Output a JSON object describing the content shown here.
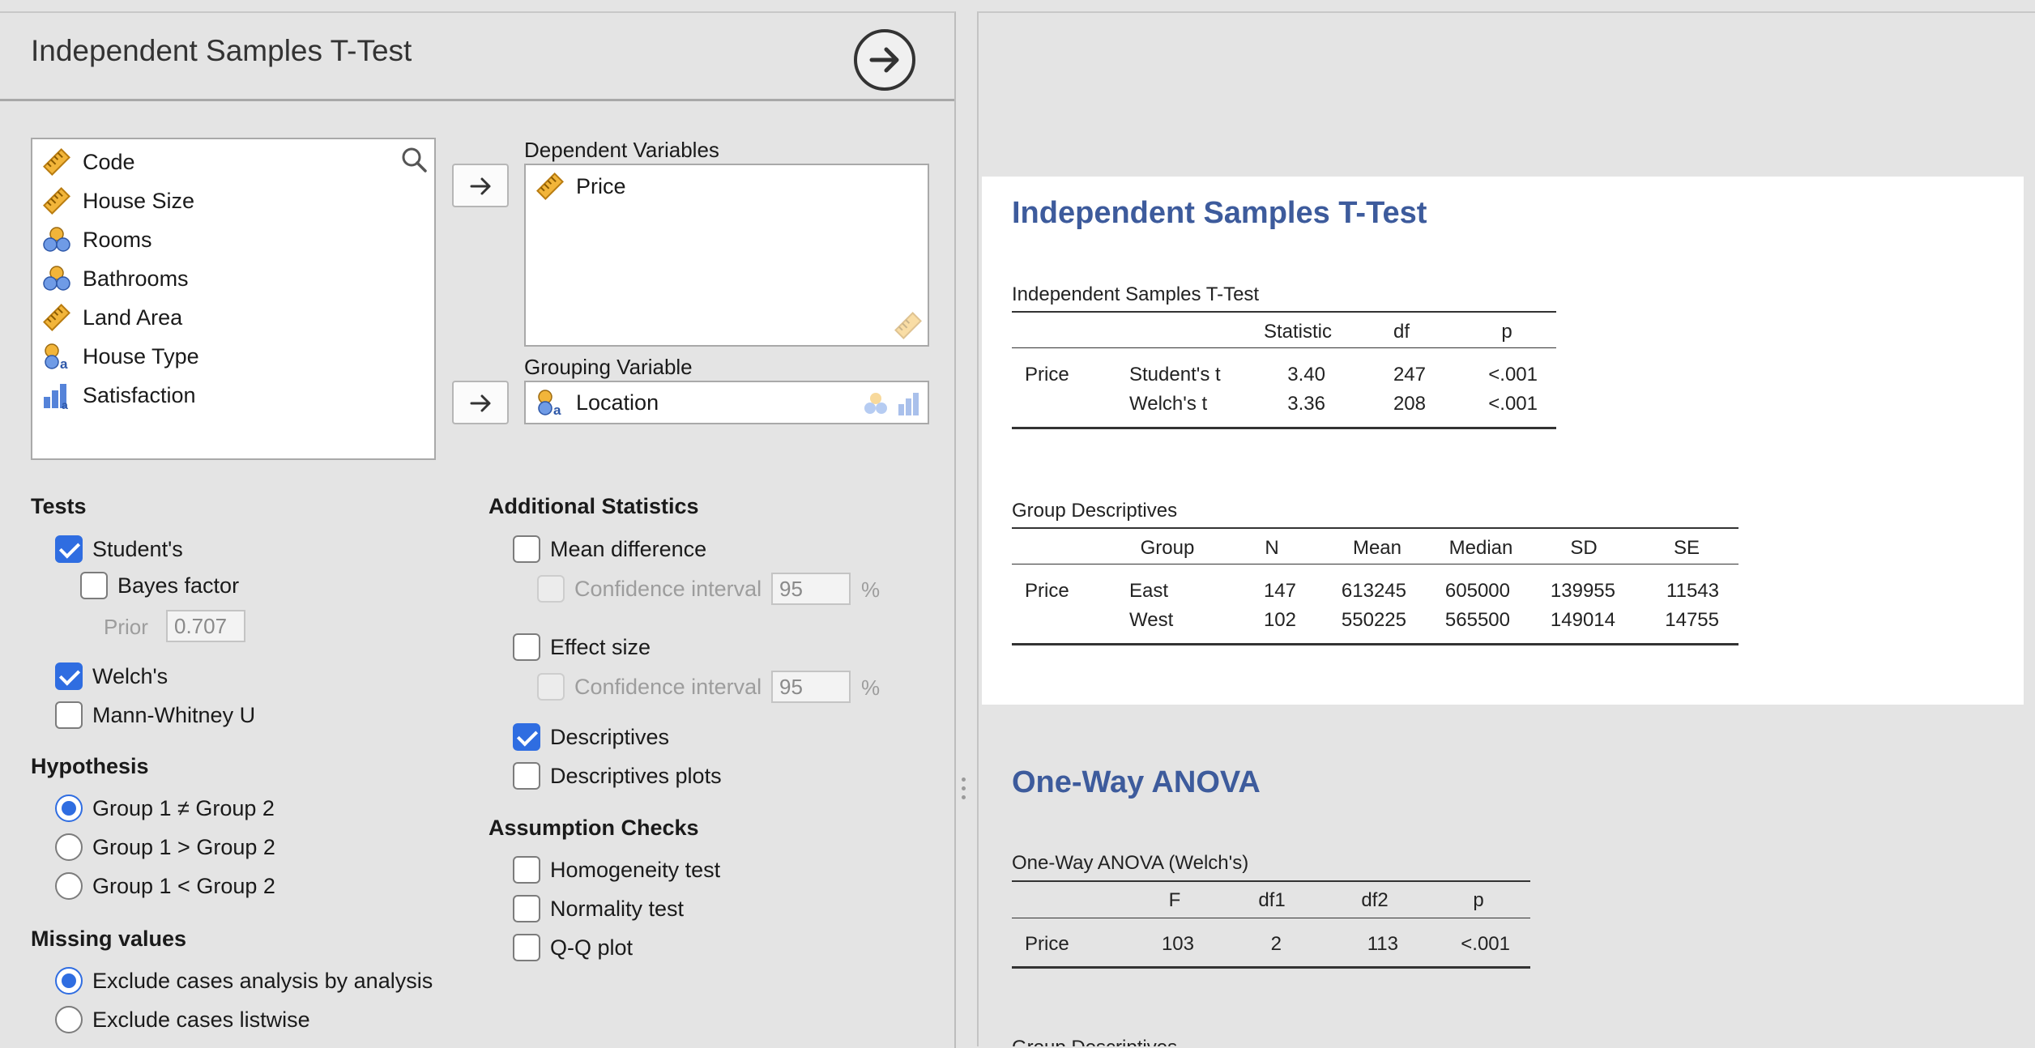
{
  "analysis": {
    "title": "Independent Samples T-Test"
  },
  "variables": [
    {
      "name": "Code",
      "icon": "scale-icon"
    },
    {
      "name": "House Size",
      "icon": "scale-icon"
    },
    {
      "name": "Rooms",
      "icon": "nominal-icon"
    },
    {
      "name": "Bathrooms",
      "icon": "nominal-icon"
    },
    {
      "name": "Land Area",
      "icon": "scale-icon"
    },
    {
      "name": "House Type",
      "icon": "nominal-text-icon"
    },
    {
      "name": "Satisfaction",
      "icon": "ordinal-icon"
    }
  ],
  "dependent": {
    "label": "Dependent Variables",
    "items": [
      {
        "name": "Price",
        "icon": "scale-icon"
      }
    ]
  },
  "grouping": {
    "label": "Grouping Variable",
    "value": "Location",
    "icon": "nominal-text-icon"
  },
  "tests": {
    "heading": "Tests",
    "students": {
      "label": "Student's",
      "checked": true
    },
    "bayes": {
      "label": "Bayes factor",
      "checked": false
    },
    "prior": {
      "label": "Prior",
      "value": "0.707"
    },
    "welchs": {
      "label": "Welch's",
      "checked": true
    },
    "mann_whitney": {
      "label": "Mann-Whitney U",
      "checked": false
    }
  },
  "hypothesis": {
    "heading": "Hypothesis",
    "options": [
      "Group 1 ≠ Group 2",
      "Group 1 > Group 2",
      "Group 1 < Group 2"
    ],
    "selected": 0
  },
  "missing": {
    "heading": "Missing values",
    "options": [
      "Exclude cases analysis by analysis",
      "Exclude cases listwise"
    ],
    "selected": 0
  },
  "additional": {
    "heading": "Additional Statistics",
    "mean_diff": {
      "label": "Mean difference",
      "checked": false
    },
    "ci1": {
      "label": "Confidence interval",
      "value": "95",
      "unit": "%"
    },
    "effect_size": {
      "label": "Effect size",
      "checked": false
    },
    "ci2": {
      "label": "Confidence interval",
      "value": "95",
      "unit": "%"
    },
    "descriptives": {
      "label": "Descriptives",
      "checked": true
    },
    "desc_plots": {
      "label": "Descriptives plots",
      "checked": false
    }
  },
  "assumption": {
    "heading": "Assumption Checks",
    "homogeneity": {
      "label": "Homogeneity test",
      "checked": false
    },
    "normality": {
      "label": "Normality test",
      "checked": false
    },
    "qq": {
      "label": "Q-Q plot",
      "checked": false
    }
  },
  "results": {
    "ttest": {
      "heading": "Independent Samples T-Test",
      "caption": "Independent Samples T-Test",
      "headers": [
        "",
        "",
        "Statistic",
        "df",
        "p"
      ],
      "rows": [
        [
          "Price",
          "Student's t",
          "3.40",
          "247",
          "<.001"
        ],
        [
          "",
          "Welch's t",
          "3.36",
          "208",
          "<.001"
        ]
      ]
    },
    "group_desc": {
      "caption": "Group Descriptives",
      "headers": [
        "",
        "Group",
        "N",
        "Mean",
        "Median",
        "SD",
        "SE"
      ],
      "rows": [
        [
          "Price",
          "East",
          "147",
          "613245",
          "605000",
          "139955",
          "11543"
        ],
        [
          "",
          "West",
          "102",
          "550225",
          "565500",
          "149014",
          "14755"
        ]
      ]
    },
    "anova": {
      "heading": "One-Way ANOVA",
      "caption": "One-Way ANOVA (Welch's)",
      "headers": [
        "",
        "F",
        "df1",
        "df2",
        "p"
      ],
      "rows": [
        [
          "Price",
          "103",
          "2",
          "113",
          "<.001"
        ]
      ]
    },
    "next_caption": "Group Descriptives"
  },
  "colors": {
    "accent": "#2f6de1",
    "result_heading": "#3d5b9c",
    "scale_icon": "#e8a631"
  }
}
